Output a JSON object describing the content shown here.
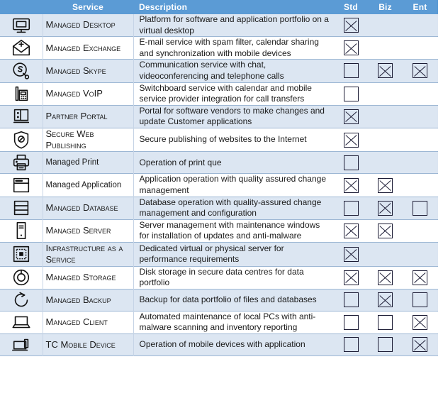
{
  "theme": {
    "header_bg": "#5b9bd5",
    "header_text": "#ffffff",
    "row_alt_bg": "#dce6f2",
    "row_plain_bg": "#ffffff",
    "grid_line": "#9db7d4",
    "text": "#1a1a1a",
    "box_stroke": "#1b1b34"
  },
  "table": {
    "columns": [
      {
        "key": "icon",
        "label": ""
      },
      {
        "key": "service",
        "label": "Service"
      },
      {
        "key": "desc",
        "label": "Description"
      },
      {
        "key": "std",
        "label": "Std"
      },
      {
        "key": "biz",
        "label": "Biz"
      },
      {
        "key": "ent",
        "label": "Ent"
      }
    ],
    "rows": [
      {
        "icon": "monitor-desktop-icon",
        "service": "Managed Desktop",
        "case": "small-caps",
        "description": "Platform for software and application portfolio on a virtual desktop",
        "std": "checked",
        "biz": "none",
        "ent": "none"
      },
      {
        "icon": "envelope-plus-icon",
        "service": "Managed Exchange",
        "case": "small-caps",
        "description": "E-mail service with spam filter, calendar sharing and synchronization with mobile devices",
        "std": "checked",
        "biz": "none",
        "ent": "none"
      },
      {
        "icon": "skype-icon",
        "service": "Managed Skype",
        "case": "small-caps",
        "description": "Communication service with chat, videoconferencing and telephone calls",
        "std": "empty",
        "biz": "checked",
        "ent": "checked"
      },
      {
        "icon": "desk-phone-icon",
        "service": "Managed VoIP",
        "case": "small-caps",
        "description": "Switchboard service with calendar and mobile service provider integration for call transfers",
        "std": "empty",
        "biz": "none",
        "ent": "none"
      },
      {
        "icon": "portal-window-icon",
        "service": "Partner Portal",
        "case": "small-caps",
        "description": "Portal for software vendors to make changes and update Customer applications",
        "std": "checked",
        "biz": "none",
        "ent": "none"
      },
      {
        "icon": "shield-block-icon",
        "service": "Secure Web Publishing",
        "case": "small-caps",
        "description": "Secure publishing of websites to the Internet",
        "std": "checked",
        "biz": "none",
        "ent": "none"
      },
      {
        "icon": "printer-icon",
        "service": "Managed Print",
        "case": "normal",
        "description": "Operation of print que",
        "std": "empty",
        "biz": "none",
        "ent": "none"
      },
      {
        "icon": "app-window-icon",
        "service": "Managed Application",
        "case": "normal",
        "description": "Application operation with quality assured change management",
        "std": "checked",
        "biz": "checked",
        "ent": "none"
      },
      {
        "icon": "database-icon",
        "service": "Managed Database",
        "case": "small-caps",
        "description": "Database operation with quality-assured change management and configuration",
        "std": "empty",
        "biz": "checked",
        "ent": "empty"
      },
      {
        "icon": "server-tower-icon",
        "service": "Managed Server",
        "case": "small-caps",
        "description": "Server management with maintenance windows for installation of updates and anti-malware",
        "std": "checked",
        "biz": "checked",
        "ent": "none"
      },
      {
        "icon": "chip-infrastructure-icon",
        "service": "Infrastructure as a Service",
        "case": "small-caps",
        "description": "Dedicated virtual or physical server for performance requirements",
        "std": "checked",
        "biz": "none",
        "ent": "none"
      },
      {
        "icon": "disk-storage-icon",
        "service": "Managed Storage",
        "case": "small-caps",
        "description": "Disk storage in secure data centres for data portfolio",
        "std": "checked",
        "biz": "checked",
        "ent": "checked"
      },
      {
        "icon": "refresh-backup-icon",
        "service": "Managed Backup",
        "case": "small-caps",
        "description": "Backup for data portfolio of files and databases",
        "std": "empty",
        "biz": "checked",
        "ent": "empty"
      },
      {
        "icon": "laptop-icon",
        "service": "Managed Client",
        "case": "small-caps",
        "description": "Automated maintenance of local PCs with anti-malware scanning and inventory reporting",
        "std": "empty",
        "biz": "empty",
        "ent": "checked"
      },
      {
        "icon": "mobile-device-icon",
        "service": "TC Mobile Device",
        "case": "small-caps",
        "description": "Operation of mobile devices with application",
        "std": "empty",
        "biz": "empty",
        "ent": "checked"
      }
    ]
  }
}
